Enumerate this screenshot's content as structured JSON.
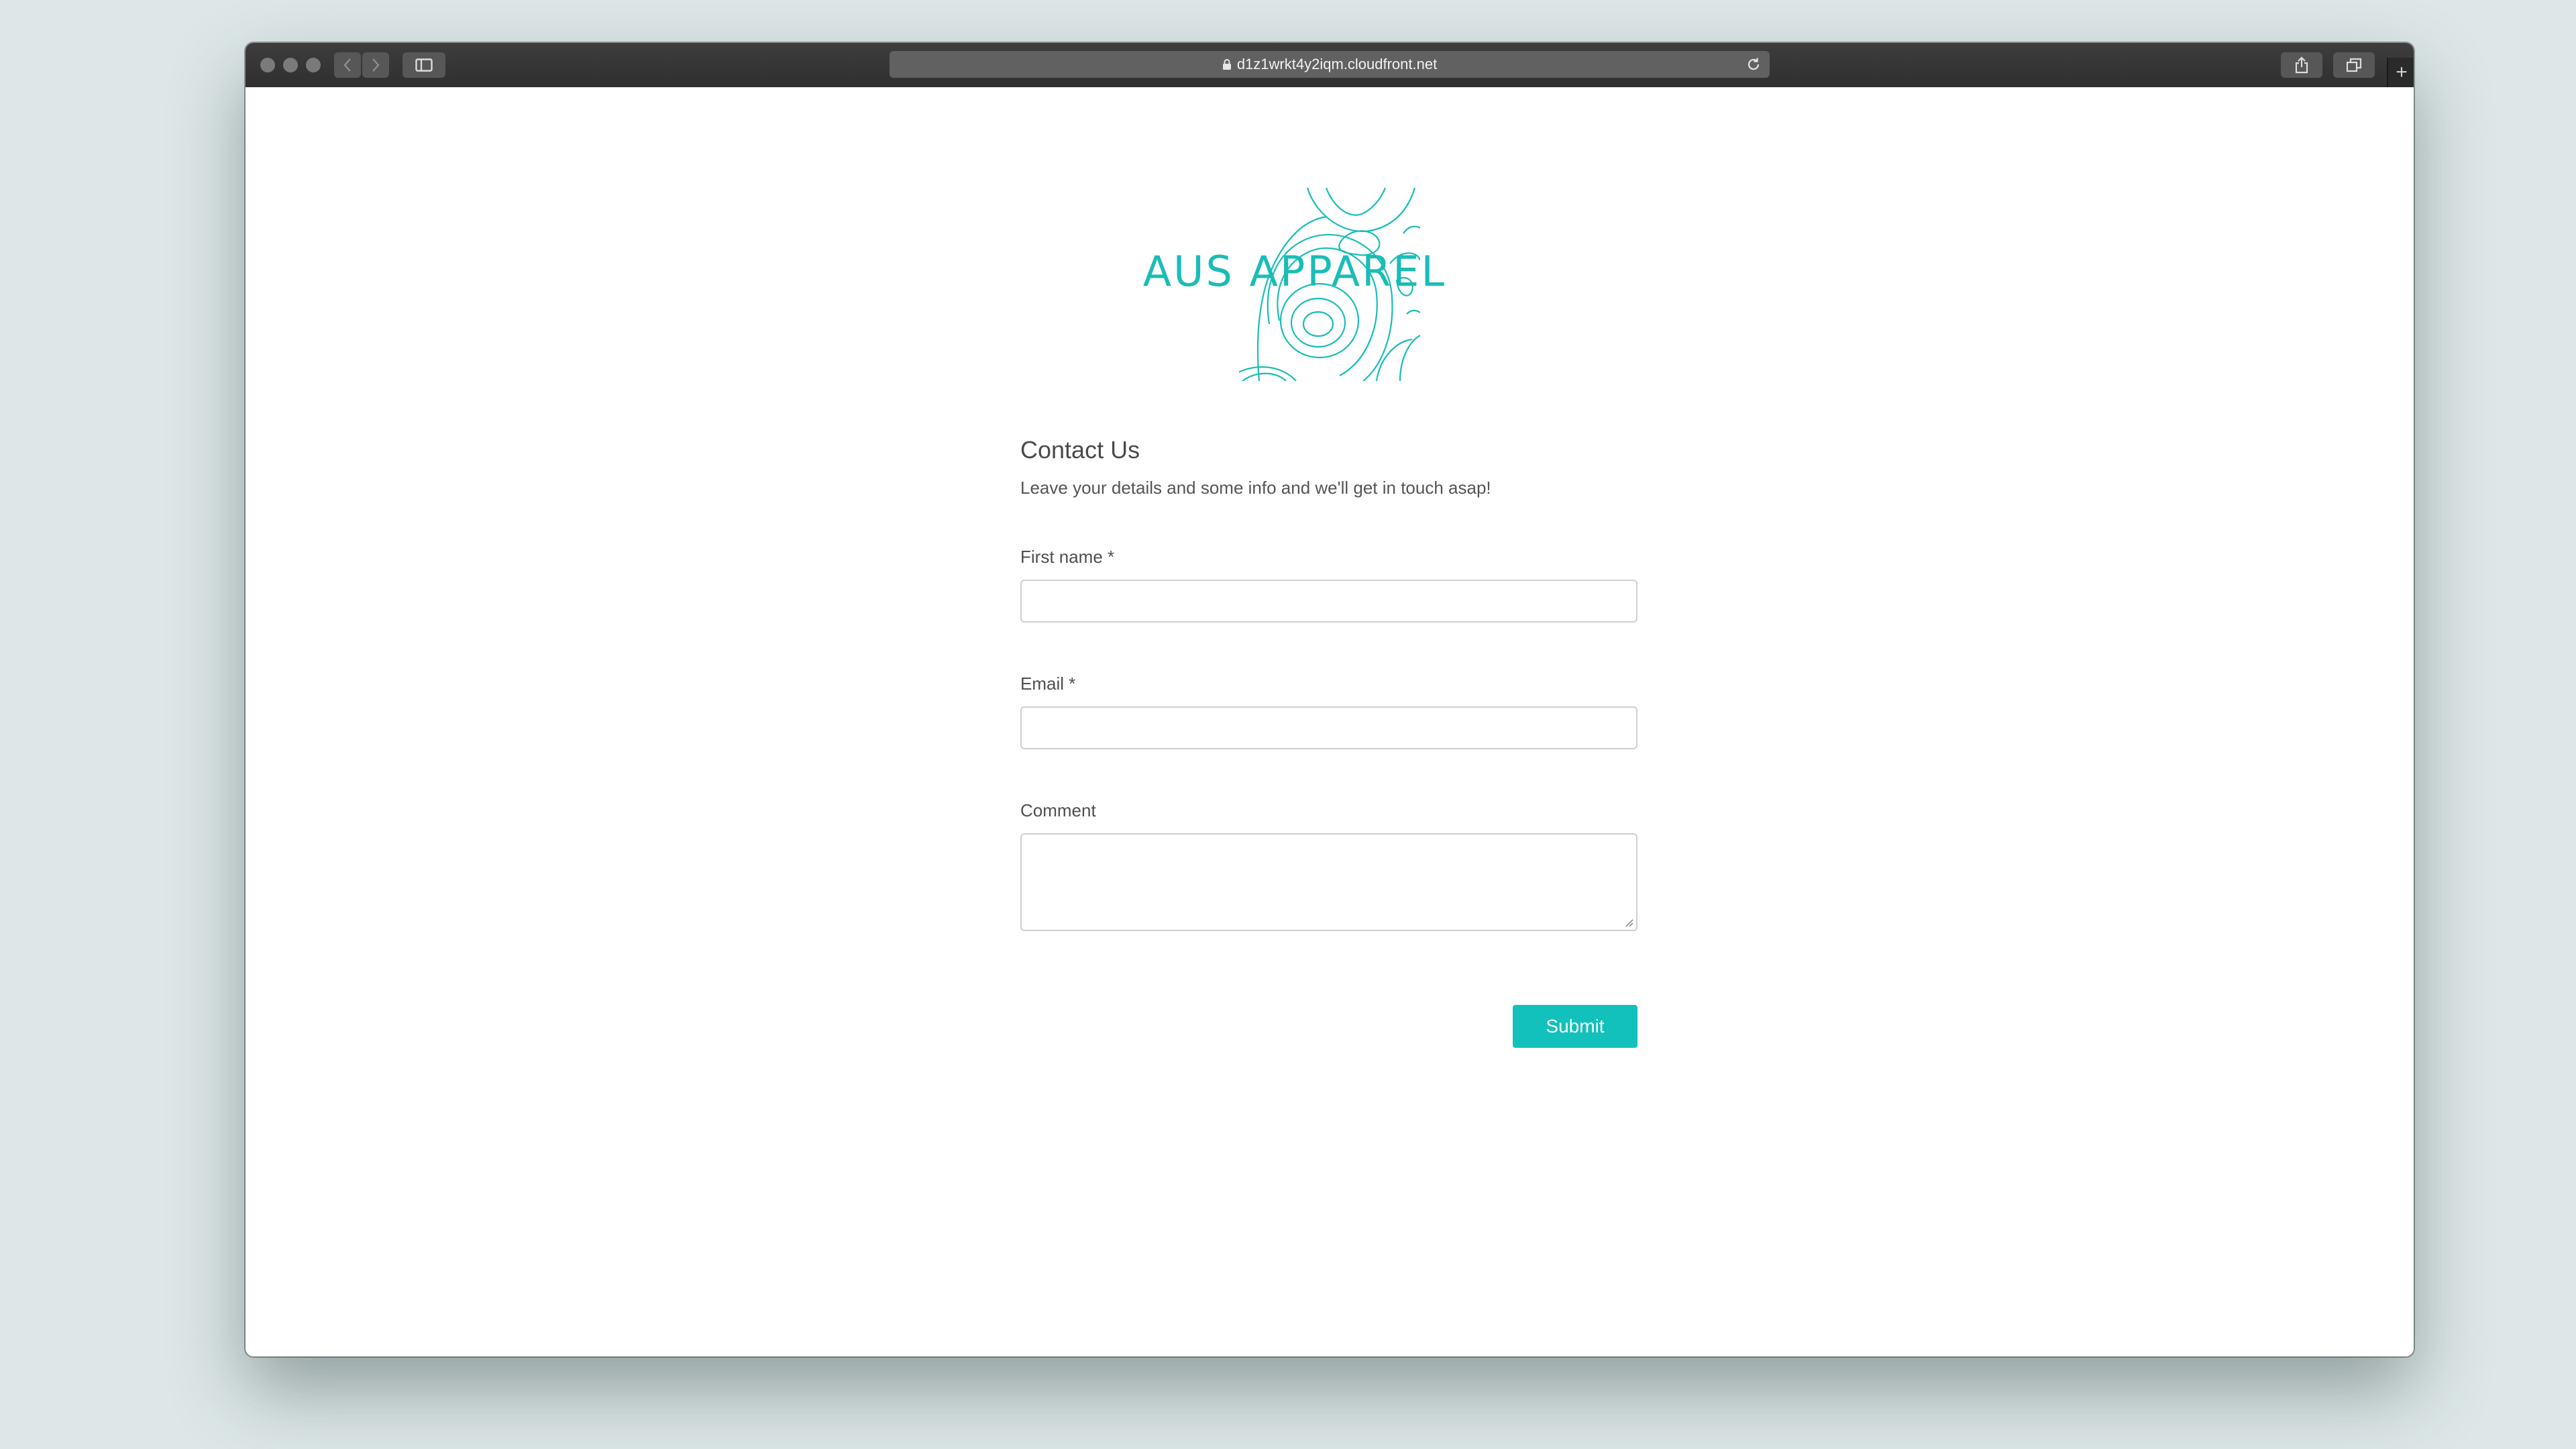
{
  "browser": {
    "url": "d1z1wrkt4y2iqm.cloudfront.net"
  },
  "brand": {
    "name": "AUS APPAREL",
    "accent_color": "#19bdb7"
  },
  "form": {
    "title": "Contact Us",
    "subtitle": "Leave your details and some info and we'll get in touch asap!",
    "fields": {
      "first_name": {
        "label": "First name *",
        "value": ""
      },
      "email": {
        "label": "Email *",
        "value": ""
      },
      "comment": {
        "label": "Comment",
        "value": ""
      }
    },
    "submit_label": "Submit"
  }
}
